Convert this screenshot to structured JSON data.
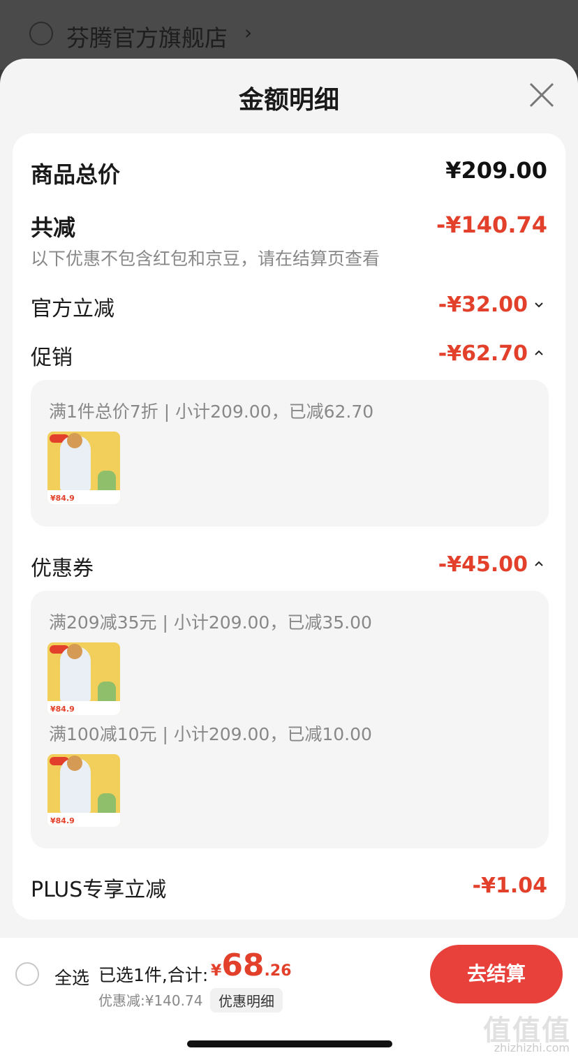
{
  "store": {
    "name": "芬腾官方旗舰店",
    "arrow": "›"
  },
  "sheet": {
    "title": "金额明细"
  },
  "summary": {
    "total_label": "商品总价",
    "total_amount": "¥209.00",
    "reduction_label": "共减",
    "reduction_amount": "-¥140.74",
    "note": "以下优惠不包含红包和京豆，请在结算页查看"
  },
  "rows": {
    "official": {
      "label": "官方立减",
      "amount": "-¥32.00",
      "state": "collapsed"
    },
    "promo": {
      "label": "促销",
      "amount": "-¥62.70",
      "state": "expanded"
    },
    "coupon": {
      "label": "优惠券",
      "amount": "-¥45.00",
      "state": "expanded"
    },
    "plus": {
      "label": "PLUS专享立减",
      "amount": "-¥1.04"
    }
  },
  "promo_detail": {
    "text": "满1件总价7折 | 小计209.00，已减62.70",
    "thumb_price": "¥84.9"
  },
  "coupon_detail": [
    {
      "text": "满209减35元 | 小计209.00，已减35.00",
      "thumb_price": "¥84.9"
    },
    {
      "text": "满100减10元 | 小计209.00，已减10.00",
      "thumb_price": "¥84.9"
    }
  ],
  "bottom": {
    "select_all": "全选",
    "selected_count": "已选1件,合计:",
    "currency": "¥",
    "total_int": "68",
    "total_dec": ".26",
    "discount": "优惠减:¥140.74",
    "detail_link": "优惠明细",
    "checkout": "去结算"
  },
  "watermark": {
    "main": "值值值",
    "sub": "zhizhizhi.com"
  },
  "colors": {
    "accent": "#e2402a",
    "checkout": "#e8403a"
  }
}
